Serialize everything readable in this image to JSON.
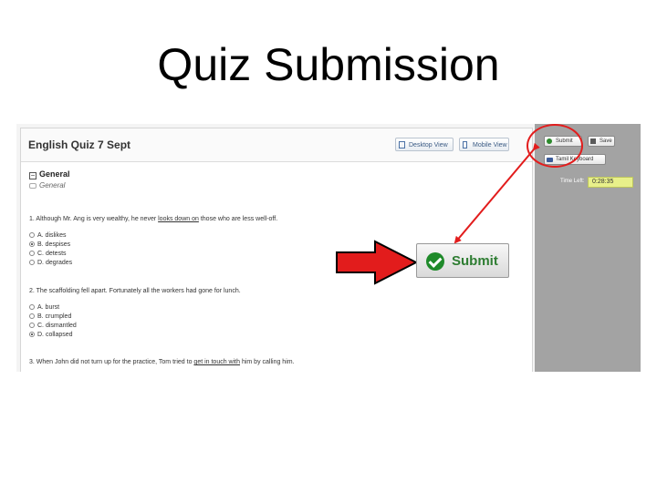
{
  "slide": {
    "title": "Quiz Submission"
  },
  "quiz": {
    "title": "English Quiz 7 Sept",
    "desktop_view": "Desktop View",
    "mobile_view": "Mobile View",
    "section_title": "General",
    "section_subtitle": "General",
    "questions": [
      {
        "text_pre": "1. Although Mr. Ang is very wealthy, he never ",
        "text_link": "looks down on",
        "text_post": " those who are less well-off.",
        "options": [
          {
            "label": "A. dislikes",
            "selected": false
          },
          {
            "label": "B. despises",
            "selected": true
          },
          {
            "label": "C. detests",
            "selected": false
          },
          {
            "label": "D. degrades",
            "selected": false
          }
        ]
      },
      {
        "text": "2. The scaffolding fell apart. Fortunately all the workers had gone for lunch.",
        "options": [
          {
            "label": "A. burst",
            "selected": false
          },
          {
            "label": "B. crumpled",
            "selected": false
          },
          {
            "label": "C. dismantled",
            "selected": false
          },
          {
            "label": "D. collapsed",
            "selected": true
          }
        ]
      },
      {
        "text_pre": "3. When John did not turn up for the practice, Tom tried to ",
        "text_link": "get in touch with",
        "text_post": " him by calling him."
      }
    ]
  },
  "sidebar": {
    "submit": "Submit",
    "save": "Save",
    "tamil_keyboard": "Tamil Keyboard",
    "time_left_label": "Time Left:",
    "time_left_value": "0:28:35"
  },
  "callout": {
    "button_label": "Submit",
    "arrow_color": "#e21c1c",
    "accent_green": "#2e7d32"
  }
}
